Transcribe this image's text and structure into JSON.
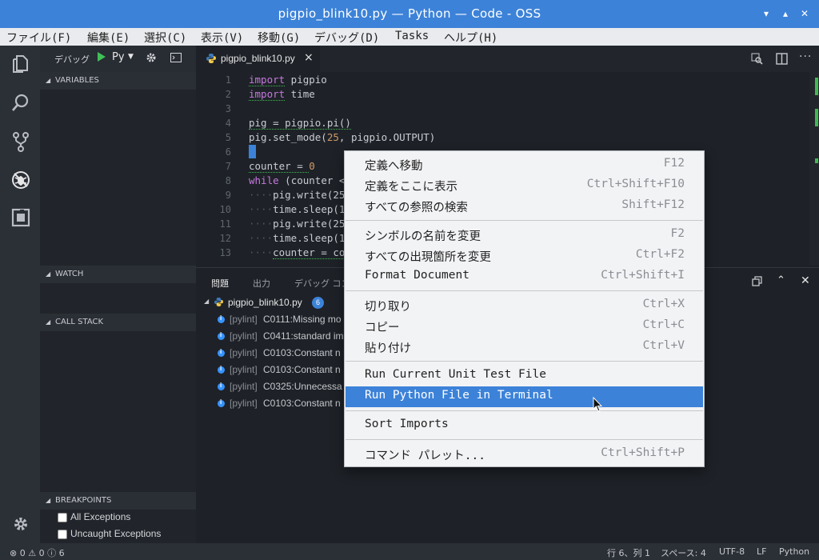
{
  "window": {
    "title": "pigpio_blink10.py — Python — Code - OSS",
    "minimize_glyph": "▾",
    "maximize_glyph": "▴",
    "close_glyph": "✕"
  },
  "menubar": [
    "ファイル(F)",
    "編集(E)",
    "選択(C)",
    "表示(V)",
    "移動(G)",
    "デバッグ(D)",
    "Tasks",
    "ヘルプ(H)"
  ],
  "debug_toolbar": {
    "label": "デバッグ",
    "config": "Py"
  },
  "sidebar": {
    "variables": "VARIABLES",
    "watch": "WATCH",
    "call_stack": "CALL STACK",
    "breakpoints": "BREAKPOINTS",
    "breakpoint_items": [
      "All Exceptions",
      "Uncaught Exceptions"
    ]
  },
  "editor": {
    "tab_label": "pigpio_blink10.py",
    "tab_close": "×",
    "line_numbers": [
      "1",
      "2",
      "3",
      "4",
      "5",
      "6",
      "7",
      "8",
      "9",
      "10",
      "11",
      "12",
      "13"
    ],
    "lines": {
      "l1_kw": "import",
      "l1_rest": " pigpio",
      "l2_kw": "import",
      "l2_rest": " time",
      "l4": "pig = pigpio.pi()",
      "l5_a": "pig.set_mode(",
      "l5_num": "25",
      "l5_b": ", pigpio.OUTPUT)",
      "l7_a": "counter = ",
      "l7_num": "0",
      "l8_kw": "while",
      "l8_rest": " (counter <",
      "l9_ws": "····",
      "l9": "pig.write(25",
      "l10_ws": "····",
      "l10": "time.sleep(1",
      "l11_ws": "····",
      "l11": "pig.write(25",
      "l12_ws": "····",
      "l12": "time.sleep(1",
      "l13_ws": "····",
      "l13": "counter = co"
    }
  },
  "panel": {
    "tabs": [
      "問題",
      "出力",
      "デバッグ コン"
    ],
    "file": "pigpio_blink10.py",
    "count": "6",
    "problems": [
      {
        "source": "[pylint]",
        "msg": "C0111:Missing mo"
      },
      {
        "source": "[pylint]",
        "msg": "C0411:standard im"
      },
      {
        "source": "[pylint]",
        "msg": "C0103:Constant n"
      },
      {
        "source": "[pylint]",
        "msg": "C0103:Constant n"
      },
      {
        "source": "[pylint]",
        "msg": "C0325:Unnecessa"
      },
      {
        "source": "[pylint]",
        "msg": "C0103:Constant n"
      }
    ]
  },
  "context_menu": [
    {
      "label": "定義へ移動",
      "key": "F12"
    },
    {
      "label": "定義をここに表示",
      "key": "Ctrl+Shift+F10"
    },
    {
      "label": "すべての参照の検索",
      "key": "Shift+F12"
    },
    {
      "label": "シンボルの名前を変更",
      "key": "F2"
    },
    {
      "label": "すべての出現箇所を変更",
      "key": "Ctrl+F2"
    },
    {
      "label": "Format Document",
      "key": "Ctrl+Shift+I"
    },
    {
      "label": "切り取り",
      "key": "Ctrl+X"
    },
    {
      "label": "コピー",
      "key": "Ctrl+C"
    },
    {
      "label": "貼り付け",
      "key": "Ctrl+V"
    },
    {
      "label": "Run Current Unit Test File",
      "key": ""
    },
    {
      "label": "Run Python File in Terminal",
      "key": ""
    },
    {
      "label": "Sort Imports",
      "key": ""
    },
    {
      "label": "コマンド パレット...",
      "key": "Ctrl+Shift+P"
    }
  ],
  "statusbar": {
    "errors": "0",
    "warnings": "0",
    "infos": "6",
    "position": "行 6、列 1",
    "spaces": "スペース: 4",
    "encoding": "UTF-8",
    "eol": "LF",
    "language": "Python"
  },
  "colors": {
    "accent": "#3c82d8",
    "keyword": "#c678dd",
    "number": "#d19a66",
    "info": "#3794ff"
  }
}
